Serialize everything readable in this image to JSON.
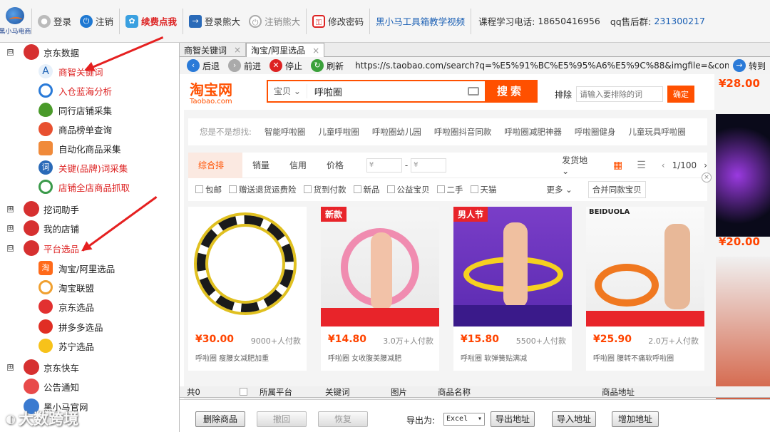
{
  "toolbar": {
    "logo_text": "黑小马电商",
    "login": "登录",
    "logout": "注销",
    "renew": "续费点我",
    "login_qianniu": "登录熊大",
    "logout_qianniu": "注销熊大",
    "change_password": "修改密码",
    "tutorial": "黑小马工具箱教学视频",
    "phone_label": "课程学习电话:",
    "phone": "18650416956",
    "qq_label": "qq售后群:",
    "qq": "231300217"
  },
  "sidebar": {
    "categories": [
      {
        "label": "京东数据",
        "expand": "⊟"
      },
      {
        "label": "挖词助手",
        "expand": "⊞"
      },
      {
        "label": "我的店铺",
        "expand": "⊞"
      },
      {
        "label": "平台选品",
        "expand": "⊟"
      },
      {
        "label": "京东快车",
        "expand": "⊞"
      },
      {
        "label": "公告通知",
        "expand": ""
      },
      {
        "label": "黑小马官网",
        "expand": ""
      }
    ],
    "jd_items": [
      "商智关键词",
      "入仓蓝海分析",
      "同行店铺采集",
      "商品榜单查询",
      "自动化商品采集",
      "关键(品牌)词采集",
      "店铺全店商品抓取"
    ],
    "platform_items": [
      "淘宝/阿里选品",
      "淘宝联盟",
      "京东选品",
      "拼多多选品",
      "苏宁选品"
    ]
  },
  "tabs": [
    {
      "label": "商智关键词",
      "close": "×"
    },
    {
      "label": "淘宝/阿里选品",
      "close": "×"
    }
  ],
  "nav": {
    "back": "后退",
    "forward": "前进",
    "stop": "停止",
    "refresh": "刷新",
    "url": "https://s.taobao.com/search?q=%E5%91%BC%E5%95%A6%E5%9C%88&imgfile=&commend=all&ssic",
    "go": "转到"
  },
  "taobao": {
    "logo": "淘宝网",
    "logo_sub": "Taobao.com",
    "scope": "宝贝",
    "query": "呼啦圈",
    "search_btn": "搜索",
    "exclude_label": "排除",
    "exclude_placeholder": "请输入要排除的词",
    "confirm": "确定",
    "suggest_label": "您是不是想找:",
    "suggestions": [
      "智能呼啦圈",
      "儿童呼啦圈",
      "呼啦圈幼儿园",
      "呼啦圈抖音同款",
      "呼啦圈减肥神器",
      "呼啦圈健身",
      "儿童玩具呼啦圈"
    ],
    "sorts": [
      "综合排序",
      "销量",
      "信用",
      "价格"
    ],
    "price_from": "¥",
    "price_to": "¥",
    "ship_from": "发货地",
    "page": "1/100",
    "filters": [
      "包邮",
      "赠送退货运费险",
      "货到付款",
      "新品",
      "公益宝贝",
      "二手",
      "天猫"
    ],
    "more": "更多",
    "merge": "合并同款宝贝",
    "products": [
      {
        "price": "¥30.00",
        "buyers": "9000+人付款",
        "badge": "",
        "desc": "呼啦圈 瘦腰女减肥加重"
      },
      {
        "price": "¥14.80",
        "buyers": "3.0万+人付款",
        "badge": "新款",
        "desc": "呼啦圈 女收腹美腰减肥"
      },
      {
        "price": "¥15.80",
        "buyers": "5500+人付款",
        "badge": "男人节",
        "desc": "呼啦圈 软弹簧贴满减"
      },
      {
        "price": "¥25.90",
        "buyers": "2.0万+人付款",
        "badge": "BEIDUOLA",
        "desc": "呼啦圈 腰转不痛软呼啦圈"
      }
    ],
    "side_prices": [
      "¥28.00",
      "¥20.00"
    ]
  },
  "table": {
    "count": "共0",
    "columns": [
      "所属平台",
      "关键词",
      "图片",
      "商品名称",
      "商品地址"
    ]
  },
  "bottom": {
    "delete": "删除商品",
    "undo": "撤回",
    "restore": "恢复",
    "export_label": "导出为:",
    "format": "Excel",
    "export_addr": "导出地址",
    "import_addr": "导入地址",
    "add_addr": "增加地址"
  },
  "watermark": "大数跨境"
}
